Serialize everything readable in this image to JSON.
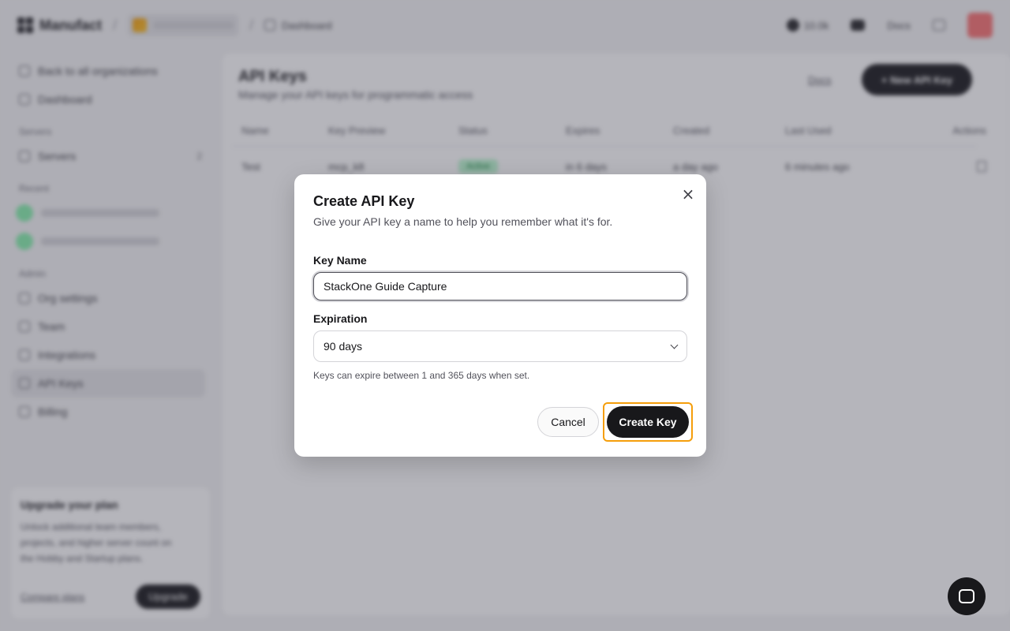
{
  "topbar": {
    "brand": "Manufact",
    "breadcrumb": "Dashboard",
    "github_stars": "10.0k",
    "docs_label": "Docs"
  },
  "sidebar": {
    "back_label": "Back to all organizations",
    "dashboard_label": "Dashboard",
    "servers_section": "Servers",
    "servers_label": "Servers",
    "servers_count": "2",
    "recent_section": "Recent",
    "admin_section": "Admin",
    "items": [
      {
        "label": "Org settings"
      },
      {
        "label": "Team"
      },
      {
        "label": "Integrations"
      },
      {
        "label": "API Keys"
      },
      {
        "label": "Billing"
      }
    ],
    "upgrade": {
      "title": "Upgrade your plan",
      "text": "Unlock additional team members, projects, and higher server count on the Hobby and Startup plans.",
      "compare_label": "Compare plans",
      "button_label": "Upgrade"
    }
  },
  "main": {
    "title": "API Keys",
    "subtitle": "Manage your API keys for programmatic access",
    "docs_link": "Docs",
    "new_button": "+ New API Key",
    "columns": [
      "Name",
      "Key Preview",
      "Status",
      "Expires",
      "Created",
      "Last Used",
      "Actions"
    ],
    "rows": [
      {
        "name": "Test",
        "preview": "mcp_k8",
        "status": "Active",
        "expires": "in 6 days",
        "created": "a day ago",
        "last_used": "6 minutes ago"
      }
    ]
  },
  "modal": {
    "title": "Create API Key",
    "description": "Give your API key a name to help you remember what it's for.",
    "key_name_label": "Key Name",
    "key_name_value": "StackOne Guide Capture",
    "expiration_label": "Expiration",
    "expiration_value": "90 days",
    "hint": "Keys can expire between 1 and 365 days when set.",
    "cancel_label": "Cancel",
    "create_label": "Create Key",
    "close_glyph": "×"
  },
  "colors": {
    "primary": "#18181b",
    "highlight": "#f59e0b",
    "status_active": "#bbf7d0"
  }
}
